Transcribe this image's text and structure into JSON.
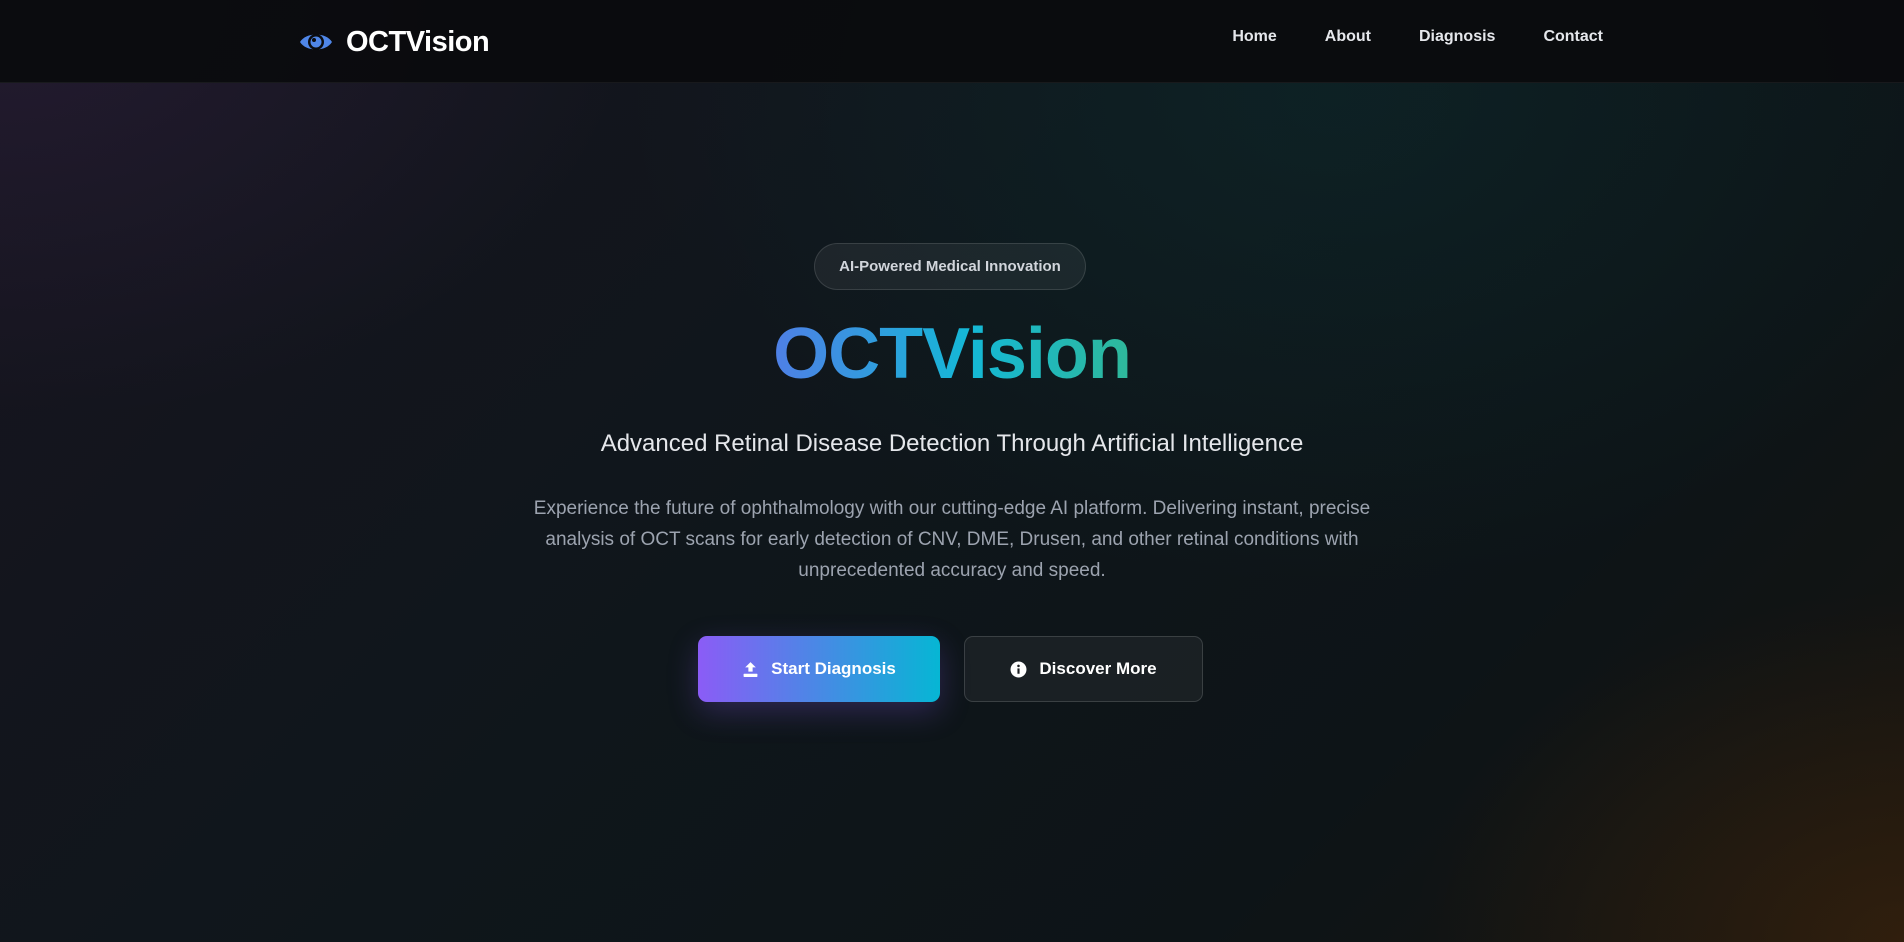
{
  "header": {
    "brand": "OCTVision",
    "nav": [
      "Home",
      "About",
      "Diagnosis",
      "Contact"
    ]
  },
  "hero": {
    "badge": "AI-Powered Medical Innovation",
    "title": "OCTVision",
    "subtitle": "Advanced Retinal Disease Detection Through Artificial Intelligence",
    "description": "Experience the future of ophthalmology with our cutting-edge AI platform. Delivering instant, precise analysis of OCT scans for early detection of CNV, DME, Drusen, and other retinal conditions with unprecedented accuracy and speed.",
    "primary_button": "Start Diagnosis",
    "secondary_button": "Discover More"
  },
  "icons": {
    "brand": "eye-icon",
    "primary_button": "upload-icon",
    "secondary_button": "info-icon"
  },
  "colors": {
    "accent_start": "#8b5cf6",
    "accent_end": "#06b6d4",
    "brand_icon": "#4f86e8"
  }
}
